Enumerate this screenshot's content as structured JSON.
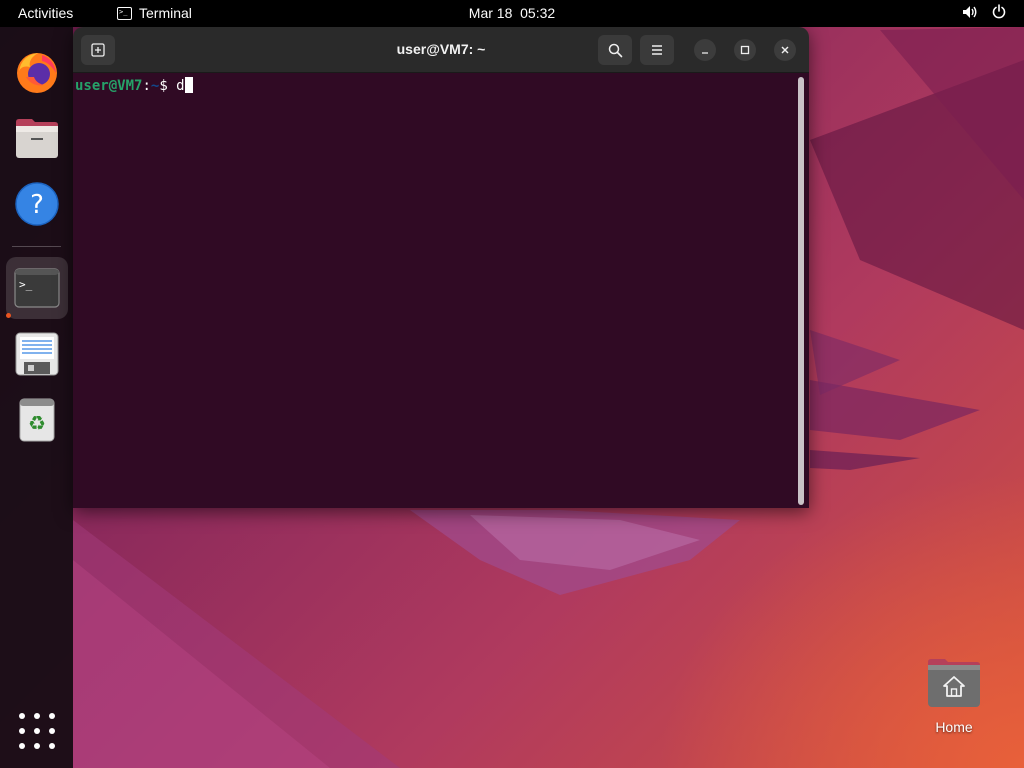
{
  "topbar": {
    "activities": "Activities",
    "app_name": "Terminal",
    "clock": "Mar 18  05:32"
  },
  "dock": {
    "items": [
      {
        "name": "Firefox",
        "icon": "firefox-icon"
      },
      {
        "name": "Files",
        "icon": "files-icon"
      },
      {
        "name": "Help",
        "icon": "help-icon",
        "glyph": "?"
      },
      {
        "name": "Terminal",
        "icon": "terminal-icon",
        "glyph": ">_",
        "active": true
      },
      {
        "name": "Text Editor",
        "icon": "text-editor-icon"
      },
      {
        "name": "Trash",
        "icon": "trash-icon",
        "glyph": "♻"
      }
    ]
  },
  "terminal": {
    "title": "user@VM7: ~",
    "prompt_user": "user@VM7",
    "prompt_sep": ":",
    "prompt_path": "~",
    "prompt_symbol": "$ ",
    "input": "d"
  },
  "desktop": {
    "home_label": "Home"
  },
  "colors": {
    "terminal_bg": "#300a24",
    "prompt_user": "#26a269",
    "prompt_path": "#12488b",
    "accent": "#e95420",
    "titlebar": "#2a2a2a"
  }
}
